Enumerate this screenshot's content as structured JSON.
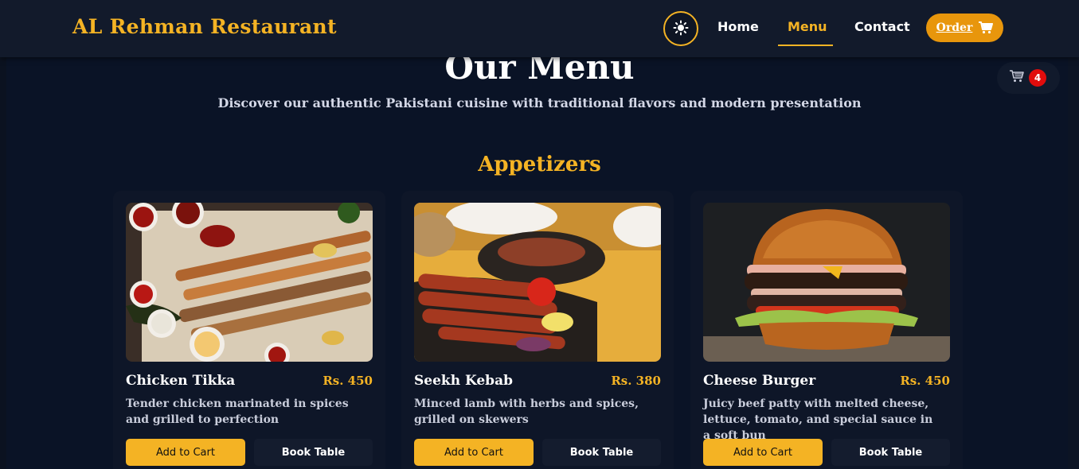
{
  "nav": {
    "brand": "AL Rehman Restaurant",
    "theme_icon": "sun-icon",
    "links": [
      {
        "label": "Home",
        "active": false
      },
      {
        "label": "Menu",
        "active": true
      },
      {
        "label": "Contact",
        "active": false
      }
    ],
    "order_label": "Order",
    "order_icon": "cart-icon"
  },
  "hero": {
    "title": "Our Menu",
    "subtitle": "Discover our authentic Pakistani cuisine with traditional flavors and modern presentation"
  },
  "floating_cart": {
    "icon": "cart-icon",
    "count": "4"
  },
  "section": {
    "title": "Appetizers"
  },
  "items": [
    {
      "name": "Chicken Tikka",
      "price": "Rs. 450",
      "description": "Tender chicken marinated in spices and grilled to perfection",
      "add_label": "Add to Cart",
      "book_label": "Book Table"
    },
    {
      "name": "Seekh Kebab",
      "price": "Rs. 380",
      "description": "Minced lamb with herbs and spices, grilled on skewers",
      "add_label": "Add to Cart",
      "book_label": "Book Table"
    },
    {
      "name": "Cheese Burger",
      "price": "Rs. 450",
      "description": "Juicy beef patty with melted cheese, lettuce, tomato, and special sauce in a soft bun",
      "add_label": "Add to Cart",
      "book_label": "Book Table"
    }
  ],
  "colors": {
    "accent": "#f4b324",
    "order_button": "#e8960c",
    "background": "#0a1326",
    "badge": "#e10c0c"
  }
}
